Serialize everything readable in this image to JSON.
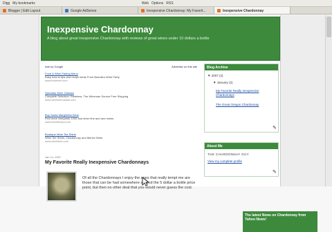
{
  "toolbar": {
    "items": [
      "Digg",
      "My bookmarks",
      "Web",
      "Options",
      "RSS"
    ]
  },
  "tabs": [
    {
      "label": "Blogger | Edit Layout",
      "active": false
    },
    {
      "label": "Google AdSense",
      "active": false
    },
    {
      "label": "Inexpensive Chardonnay: My Favorit...",
      "active": false
    },
    {
      "label": "Inexpensive Chardonnay",
      "active": true
    }
  ],
  "header": {
    "title": "Inexpensive Chardonnay",
    "description": "A blog about great inexpensive Chardonnay with reviews of great wines under 10 dollars a bottle"
  },
  "ads": {
    "links": [
      "Ads by Google",
      "Advertise on this site"
    ],
    "items": [
      {
        "title": "Food & Wine Pairing Menu",
        "text": "Easy how-to tips and recipe ideas From Beaulieu Wine Party.",
        "url": "www.bvwines.com"
      },
      {
        "title": "Specialty Wine Glasses",
        "text": "Complete Selection: Stemless, The Wineman Source Free Shipping",
        "url": "www.wineenthusiast.com"
      },
      {
        "title": "Buy Santa Margherita Wine",
        "text": "Find more vineyards 1000 and other fine and rare wines.",
        "url": "www.winelibrary.com"
      },
      {
        "title": "Boutique Wine Tea Shirts",
        "text": "Wine Tee Shirts, Chardonnay and Merlot Shirts",
        "url": "www.winetees.com"
      }
    ]
  },
  "post": {
    "date": "Jan 14, 2007",
    "title": "My Favorite Really Inexpensive Chardonnays",
    "body": "Of all the Chardonnays I enjoy the ones that really tempt me are those that can be had somewhere around the 5 dollar a bottle price point, but then no other deal that you would never guess the cost."
  },
  "sidebar": {
    "archive_title": "Blog Archive",
    "archive_year": "2007",
    "archive_year_count": "(2)",
    "archive_month": "January",
    "archive_month_count": "(2)",
    "archive_posts": [
      "My Favorite Really Inexpensive Chardonnays",
      "The Great Oregon Chardonnay"
    ],
    "about_title": "About Me",
    "about_name": "THE CHARDONNAY GUY",
    "about_link": "View my complete profile",
    "news_title": "The latest News on Chardonnay from Yahoo News!"
  },
  "colors": {
    "header_green": "#3d8a3d",
    "link_blue": "#1a4fa0"
  }
}
